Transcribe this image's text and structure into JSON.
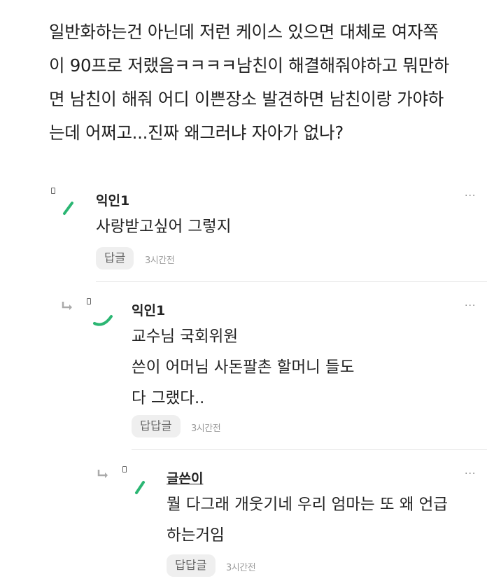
{
  "post": {
    "lines": [
      "일반화하는건 아닌데 저런 케이스 있으면 대체로 여자쪽",
      "이 90프로 저랬음ㅋㅋㅋㅋ남친이 해결해줘야하고 뭐만하",
      "면 남친이 해줘 어디 이쁜장소 발견하면 남친이랑 가야하",
      "는데 어쩌고...진짜 왜그러냐 자아가 없나?"
    ]
  },
  "comments": [
    {
      "author": "익인1",
      "lines": [
        "사랑받고싶어 그렇지"
      ],
      "reply_label": "답글",
      "time": "3시간전",
      "more": "···"
    },
    {
      "author": "익인1",
      "lines": [
        "교수님 국회위원",
        "쓴이 어머님 사돈팔촌 할머니 들도",
        "다 그랬다.."
      ],
      "reply_label": "답답글",
      "time": "3시간전",
      "more": "···"
    },
    {
      "author": "글쓴이",
      "lines": [
        "뭘 다그래 개웃기네 우리 엄마는 또 왜 언급",
        "하는거임"
      ],
      "reply_label": "답답글",
      "time": "3시간전",
      "more": "···"
    }
  ],
  "colors": {
    "accent": "#2bb673",
    "divider": "#e6e6e6",
    "button_bg": "#efefef"
  },
  "icons": {
    "more": "more-dots-icon",
    "reply": "reply-arrow-icon",
    "avatar": "avatar-icon"
  }
}
